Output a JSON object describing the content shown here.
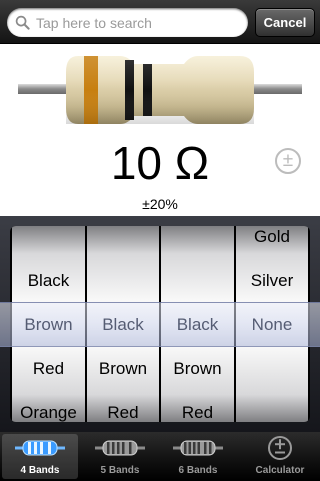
{
  "search": {
    "placeholder": "Tap here to search",
    "cancel_label": "Cancel"
  },
  "display": {
    "value": "10 Ω",
    "tolerance": "±20%",
    "tolerance_button": "±",
    "band_colors": {
      "band1": "#c77f10",
      "band2": "#111111",
      "band3": "#111111"
    }
  },
  "picker": {
    "columns": [
      [
        "",
        "Black",
        "Brown",
        "Red",
        "Orange"
      ],
      [
        "",
        "",
        "Black",
        "Brown",
        "Red"
      ],
      [
        "",
        "",
        "Black",
        "Brown",
        "Red"
      ],
      [
        "Gold",
        "Silver",
        "None",
        "",
        ""
      ]
    ]
  },
  "tabs": [
    {
      "label": "4 Bands",
      "icon": "resistor-4-band-icon",
      "active": true
    },
    {
      "label": "5 Bands",
      "icon": "resistor-5-band-icon",
      "active": false
    },
    {
      "label": "6 Bands",
      "icon": "resistor-6-band-icon",
      "active": false
    },
    {
      "label": "Calculator",
      "icon": "plus-minus-circle-icon",
      "active": false
    }
  ]
}
